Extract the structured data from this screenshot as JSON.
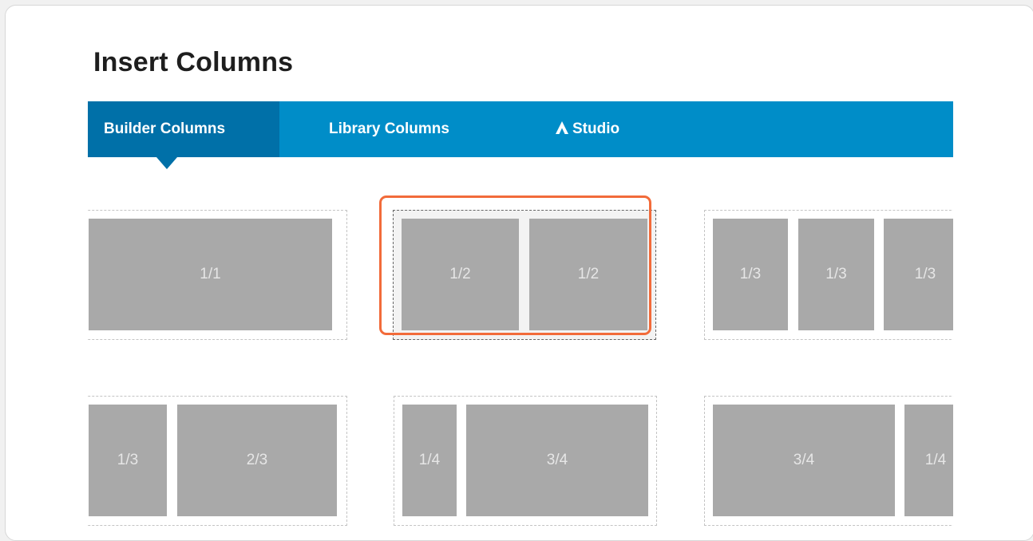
{
  "dialog": {
    "title": "Insert Columns"
  },
  "tabs": [
    {
      "label": "Builder Columns",
      "active": true
    },
    {
      "label": "Library Columns",
      "active": false
    },
    {
      "label": "Studio",
      "active": false,
      "icon": "studio-logo-icon"
    }
  ],
  "colors": {
    "tab_bar": "#008dc8",
    "active_tab": "#0070a8",
    "highlight": "#f26b3a",
    "column_block": "#a9a9a9"
  },
  "layouts": [
    {
      "name": "layout-full",
      "columns": [
        "1/1"
      ],
      "selected": false
    },
    {
      "name": "layout-halves",
      "columns": [
        "1/2",
        "1/2"
      ],
      "selected": true
    },
    {
      "name": "layout-thirds",
      "columns": [
        "1/3",
        "1/3",
        "1/3"
      ],
      "selected": false
    },
    {
      "name": "layout-third-two-thirds",
      "columns": [
        "1/3",
        "2/3"
      ],
      "selected": false
    },
    {
      "name": "layout-quarter-three-quarters",
      "columns": [
        "1/4",
        "3/4"
      ],
      "selected": false
    },
    {
      "name": "layout-three-quarters-quarter",
      "columns": [
        "3/4",
        "1/4"
      ],
      "selected": false
    }
  ]
}
